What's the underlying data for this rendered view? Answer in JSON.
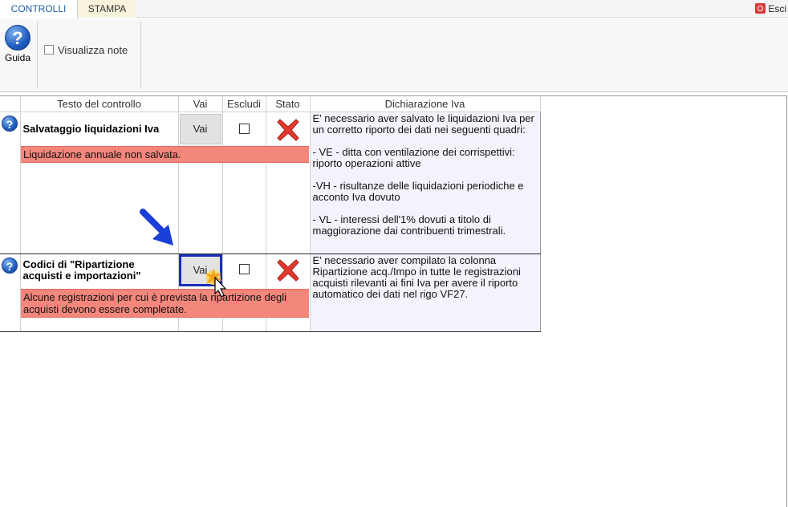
{
  "tabs": [
    {
      "label": "CONTROLLI"
    },
    {
      "label": "STAMPA"
    }
  ],
  "exit_label": "Esci",
  "ribbon": {
    "guida_label": "Guida",
    "visualizza_note_label": "Visualizza note",
    "visualizza_note_checked": false
  },
  "table": {
    "headers": [
      "Testo del controllo",
      "Vai",
      "Escludi",
      "Stato",
      "Dichiarazione Iva"
    ],
    "rows": [
      {
        "title": "Salvataggio liquidazioni Iva",
        "vai_label": "Vai",
        "escludi_checked": false,
        "stato": "error",
        "dichiarazione": "E' necessario aver salvato le liquidazioni Iva per un corretto riporto dei dati nei seguenti quadri:\n\n- VE - ditta con ventilazione dei corrispettivi: riporto operazioni attive\n\n-VH - risultanze delle liquidazioni periodiche e acconto Iva dovuto\n\n- VL - interessi dell'1% dovuti a titolo di maggiorazione dai contribuenti trimestrali.",
        "error_message": "Liquidazione annuale non salvata."
      },
      {
        "title": "Codici di \"Ripartizione acquisti e importazioni\"",
        "vai_label": "Vai",
        "escludi_checked": false,
        "stato": "error",
        "dichiarazione": "E' necessario aver compilato la colonna Ripartizione acq./Impo in tutte le registrazioni acquisti rilevanti ai fini Iva per avere il riporto automatico dei dati nel rigo VF27.",
        "error_message": "Alcune registrazioni per cui è prevista la ripartizione degli acquisti devono essere completate."
      }
    ]
  },
  "colors": {
    "tab_active_text": "#1f5fa8",
    "error_bg": "#f4877c",
    "dich_bg": "#f5f2fb",
    "focus_border": "#1a2fb8",
    "arrow": "#1a3fd6"
  }
}
